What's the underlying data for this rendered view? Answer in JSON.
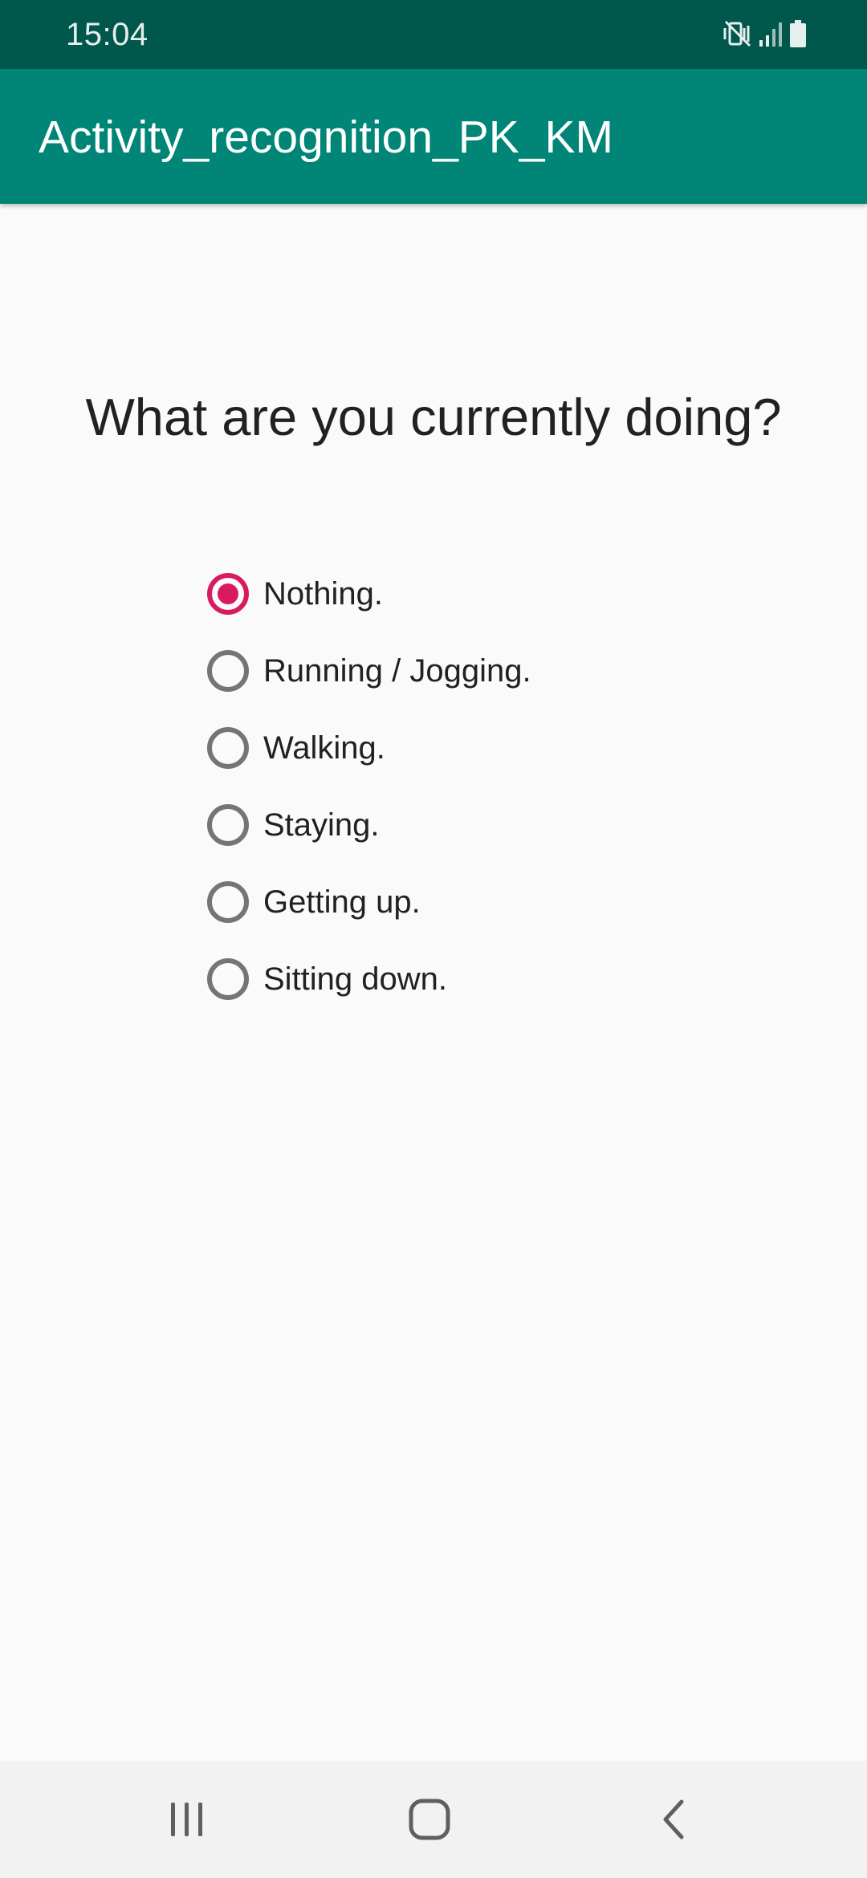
{
  "status_bar": {
    "time": "15:04",
    "icons": [
      "vibrate-mute-icon",
      "signal-icon",
      "battery-icon"
    ]
  },
  "app_bar": {
    "title": "Activity_recognition_PK_KM",
    "color": "#008577"
  },
  "main": {
    "question": "What are you currently doing?",
    "options": [
      {
        "label": "Nothing.",
        "checked": true
      },
      {
        "label": "Running / Jogging.",
        "checked": false
      },
      {
        "label": "Walking.",
        "checked": false
      },
      {
        "label": "Staying.",
        "checked": false
      },
      {
        "label": "Getting up.",
        "checked": false
      },
      {
        "label": "Sitting down.",
        "checked": false
      }
    ],
    "accent_color": "#d81b60"
  },
  "nav_bar": {
    "buttons": [
      "recents-icon",
      "home-icon",
      "back-icon"
    ]
  }
}
